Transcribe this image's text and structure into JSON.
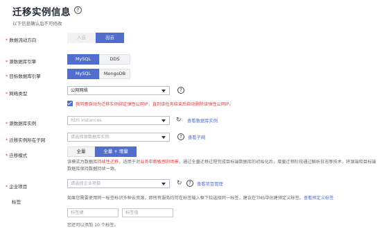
{
  "header": {
    "title": "迁移实例信息",
    "help_glyph": "?",
    "subtitle": "以下信息确认后不可修改"
  },
  "direction": {
    "label": "数据流动方向",
    "options": [
      "入云",
      "出云"
    ],
    "selected": "出云"
  },
  "source_engine": {
    "label": "源数据库引擎",
    "options": [
      "MySQL",
      "DDS"
    ],
    "selected": "MySQL"
  },
  "target_engine": {
    "label": "目标数据库引擎",
    "options": [
      "MySQL",
      "MongoDB"
    ],
    "selected": "MySQL"
  },
  "network": {
    "label": "网络类型",
    "value": "公网网络",
    "help_glyph": "?",
    "checkbox_checked": true,
    "checkbox_text": "我同意自动为迁移实例绑定弹性公网IP，直到该任务结束后自动删除该弹性公网IP。"
  },
  "source_instance": {
    "label": "源数据库实例",
    "placeholder": "RDS Instances",
    "link": "查看数据库实例"
  },
  "subnet": {
    "label": "迁移实例所在子网",
    "placeholder": "请选择源数据库实例",
    "help_glyph": "?",
    "link": "查看子网"
  },
  "mode": {
    "label": "迁移模式",
    "options": [
      "全量",
      "全量 + 增量"
    ],
    "selected": "全量 + 增量",
    "desc_line1_a": "该模式为数据库",
    "desc_line1_hl1": "持续性迁移",
    "desc_line1_b": "，适用于对",
    "desc_line1_hl2": "业务中断敏感的场景",
    "desc_line1_c": "，通过全量迁移过程完成目标端数据库的初始化后，增量迁移阶段通过解析日志等技术，将源端和目标端数据库",
    "desc_line2": "保持数据持续一致。"
  },
  "project": {
    "label": "企业项目",
    "placeholder": "请选择企业项目",
    "help_glyph": "?",
    "link": "查看项目管理"
  },
  "tags": {
    "label": "标签",
    "desc_text": "如果您需要使用同一标签标识多种云资源，即所有服务均可在标签输入框下拉选择同一标签，建议在TMS中创建预定义标签。",
    "desc_link": "查看预定义标签",
    "key_placeholder": "标签键",
    "value_placeholder": "标签值",
    "hint": "您还可以添加 10 个标签。"
  }
}
